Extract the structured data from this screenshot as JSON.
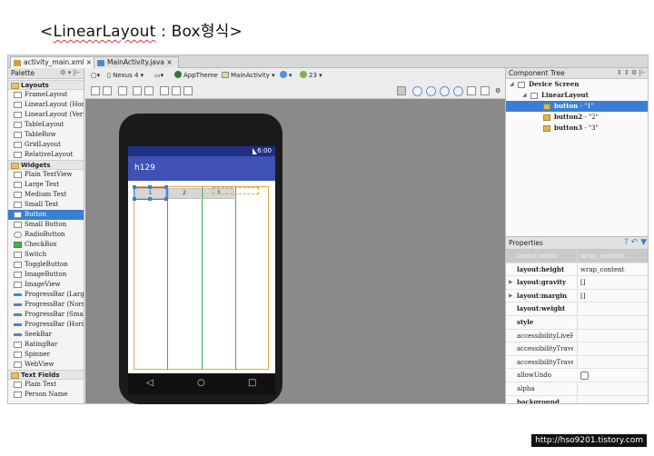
{
  "slide_title": {
    "prefix": "<",
    "underlined": "LinearLayout",
    "rest": " : Box형식>"
  },
  "tabs": [
    {
      "label": "activity_main.xml",
      "active": true
    },
    {
      "label": "MainActivity.java",
      "active": false
    }
  ],
  "palette": {
    "title": "Palette",
    "header_icons": "⚙ ▾ |⊢",
    "sections": [
      {
        "category": "Layouts",
        "items": [
          "FrameLayout",
          "LinearLayout (Horiz",
          "LinearLayout (Verti",
          "TableLayout",
          "TableRow",
          "GridLayout",
          "RelativeLayout"
        ]
      },
      {
        "category": "Widgets",
        "items": [
          "Plain TextView",
          "Large Text",
          "Medium Text",
          "Small Text",
          "Button",
          "Small Button",
          "RadioButton",
          "CheckBox",
          "Switch",
          "ToggleButton",
          "ImageButton",
          "ImageView",
          "ProgressBar (Large",
          "ProgressBar (Norm",
          "ProgressBar (Small",
          "ProgressBar (Horiz",
          "SeekBar",
          "RatingBar",
          "Spinner",
          "WebView"
        ]
      },
      {
        "category": "Text Fields",
        "items": [
          "Plain Text",
          "Person Name"
        ]
      }
    ],
    "selected_item": "Button"
  },
  "toolbar": {
    "device": "Nexus 4",
    "theme": "AppTheme",
    "activity": "MainActivity",
    "api": "23"
  },
  "phone": {
    "status_time": "6:00",
    "app_title": "h129",
    "buttons": [
      "1",
      "2",
      "3"
    ],
    "nav": [
      "◁",
      "○",
      "□"
    ]
  },
  "component_tree": {
    "title": "Component Tree",
    "nodes": [
      {
        "label": "Device Screen",
        "indent": 0
      },
      {
        "label": "LinearLayout",
        "indent": 1
      },
      {
        "label": "button",
        "suffix": " - \"1\"",
        "indent": 2,
        "selected": true
      },
      {
        "label": "button2",
        "suffix": " - \"2\"",
        "indent": 2,
        "selected": false
      },
      {
        "label": "button3",
        "suffix": " - \"3\"",
        "indent": 2,
        "selected": false
      }
    ]
  },
  "properties": {
    "title": "Properties",
    "rows": [
      {
        "name": "layout:width",
        "value": "wrap_content",
        "bold": false,
        "header": true,
        "expand": false
      },
      {
        "name": "layout:height",
        "value": "wrap_content",
        "bold": true,
        "header": false,
        "expand": false
      },
      {
        "name": "layout:gravity",
        "value": "[]",
        "bold": true,
        "header": false,
        "expand": true
      },
      {
        "name": "layout:margin",
        "value": "[]",
        "bold": true,
        "header": false,
        "expand": true
      },
      {
        "name": "layout:weight",
        "value": "",
        "bold": true,
        "header": false,
        "expand": false
      },
      {
        "name": "style",
        "value": "",
        "bold": true,
        "header": false,
        "expand": false
      },
      {
        "name": "accessibilityLiveReg",
        "value": "",
        "bold": false,
        "header": false,
        "expand": false
      },
      {
        "name": "accessibilityTravers",
        "value": "",
        "bold": false,
        "header": false,
        "expand": false
      },
      {
        "name": "accessibilityTravers",
        "value": "",
        "bold": false,
        "header": false,
        "expand": false
      },
      {
        "name": "allowUndo",
        "value": "",
        "bold": false,
        "header": false,
        "expand": false,
        "checkbox": true
      },
      {
        "name": "alpha",
        "value": "",
        "bold": false,
        "header": false,
        "expand": false
      },
      {
        "name": "background",
        "value": "",
        "bold": true,
        "header": false,
        "expand": false
      }
    ]
  },
  "watermark": "http://hso9201.tistory.com"
}
